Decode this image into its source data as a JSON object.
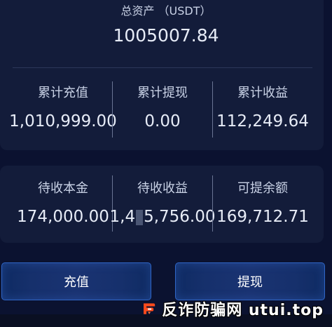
{
  "total": {
    "label": "总资产 （USDT）",
    "value": "1005007.84"
  },
  "summary": [
    {
      "label": "累计充值",
      "value": "1,010,999.00"
    },
    {
      "label": "累计提现",
      "value": "0.00"
    },
    {
      "label": "累计收益",
      "value": "112,249.64"
    }
  ],
  "pending": [
    {
      "label": "待收本金",
      "value": "174,000.00"
    },
    {
      "label": "待收收益",
      "value_prefix": "1,4",
      "value_suffix": "5,756.00"
    },
    {
      "label": "可提余额",
      "value": "169,712.71"
    }
  ],
  "buttons": {
    "recharge": "充值",
    "withdraw": "提现"
  },
  "watermark": {
    "text": "反诈防骗网 utui.top",
    "logo": "brand-logo"
  }
}
